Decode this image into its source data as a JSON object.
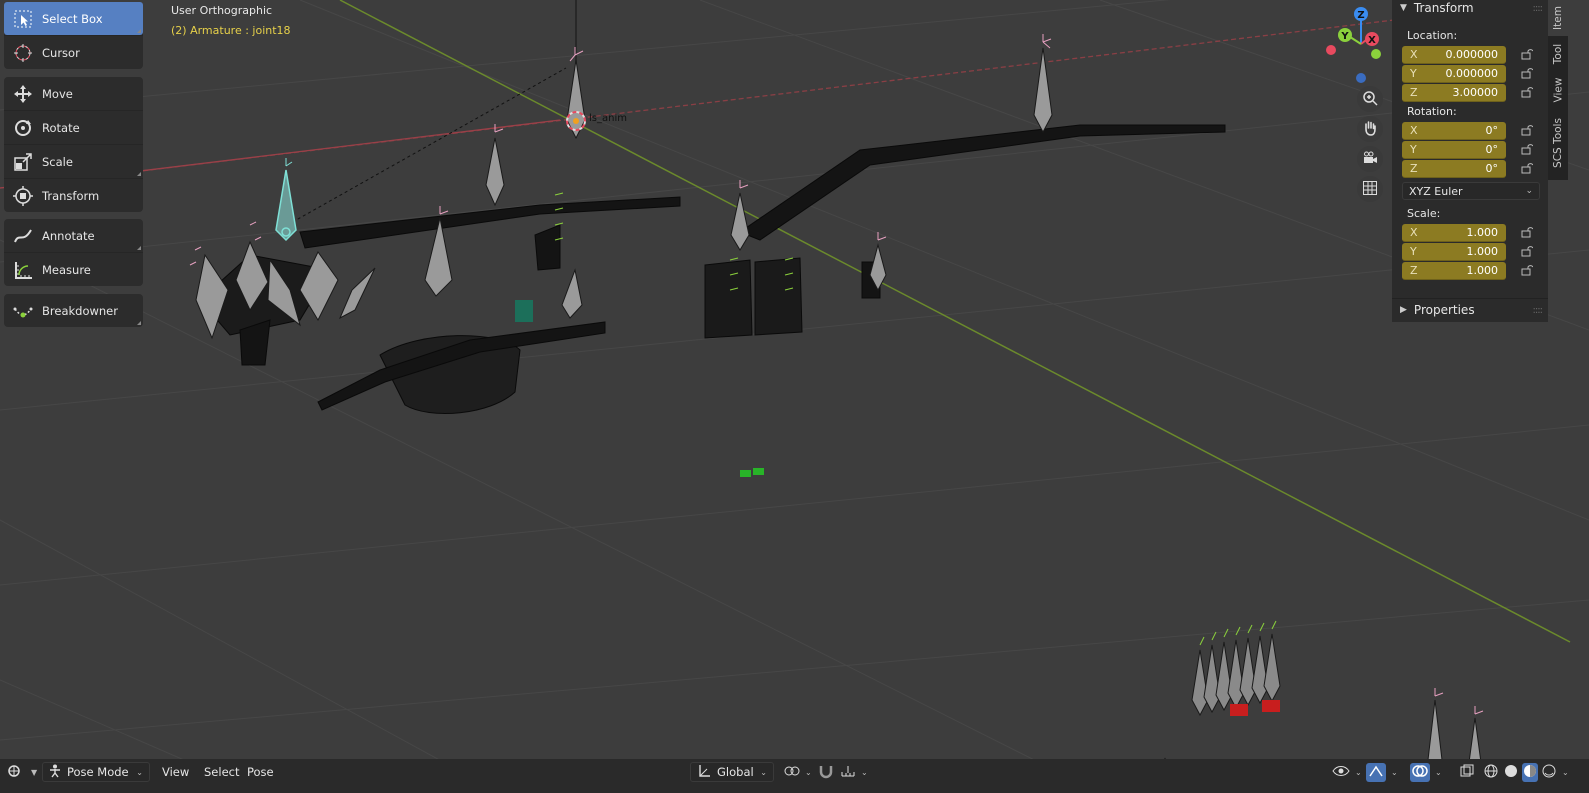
{
  "viewport": {
    "view_name": "User Orthographic",
    "active_object": "(2) Armature : joint18",
    "object_label": "ls_anim"
  },
  "toolbar": {
    "tools": [
      {
        "label": "Select Box",
        "icon": "select-box-icon",
        "active": true
      },
      {
        "label": "Cursor",
        "icon": "cursor-icon"
      },
      {
        "label": "Move",
        "icon": "move-icon"
      },
      {
        "label": "Rotate",
        "icon": "rotate-icon"
      },
      {
        "label": "Scale",
        "icon": "scale-icon"
      },
      {
        "label": "Transform",
        "icon": "transform-icon"
      },
      {
        "label": "Annotate",
        "icon": "annotate-icon"
      },
      {
        "label": "Measure",
        "icon": "measure-icon"
      },
      {
        "label": "Breakdowner",
        "icon": "breakdowner-icon"
      }
    ]
  },
  "gizmo": {
    "x": "X",
    "y": "Y",
    "z": "Z"
  },
  "sidebar": {
    "tabs": [
      "Item",
      "Tool",
      "View",
      "SCS Tools"
    ],
    "active_tab": "Item",
    "transform_title": "Transform",
    "location_label": "Location:",
    "location": [
      {
        "axis": "X",
        "value": "0.000000"
      },
      {
        "axis": "Y",
        "value": "0.000000"
      },
      {
        "axis": "Z",
        "value": "3.00000"
      }
    ],
    "rotation_label": "Rotation:",
    "rotation": [
      {
        "axis": "X",
        "value": "0°"
      },
      {
        "axis": "Y",
        "value": "0°"
      },
      {
        "axis": "Z",
        "value": "0°"
      }
    ],
    "rotation_mode": "XYZ Euler",
    "scale_label": "Scale:",
    "scale": [
      {
        "axis": "X",
        "value": "1.000"
      },
      {
        "axis": "Y",
        "value": "1.000"
      },
      {
        "axis": "Z",
        "value": "1.000"
      }
    ],
    "properties_title": "Properties"
  },
  "header": {
    "mode": "Pose Mode",
    "menus": [
      "View",
      "Select",
      "Pose"
    ],
    "orientation": "Global"
  },
  "colors": {
    "viewport_bg": "#3d3d3d",
    "active_tool": "#5680c2",
    "field_animated": "#8c7b22",
    "axis_x": "#e84a5f",
    "axis_y": "#8bd13c",
    "axis_z": "#3a8cf0",
    "active_text": "#e6d04a"
  }
}
